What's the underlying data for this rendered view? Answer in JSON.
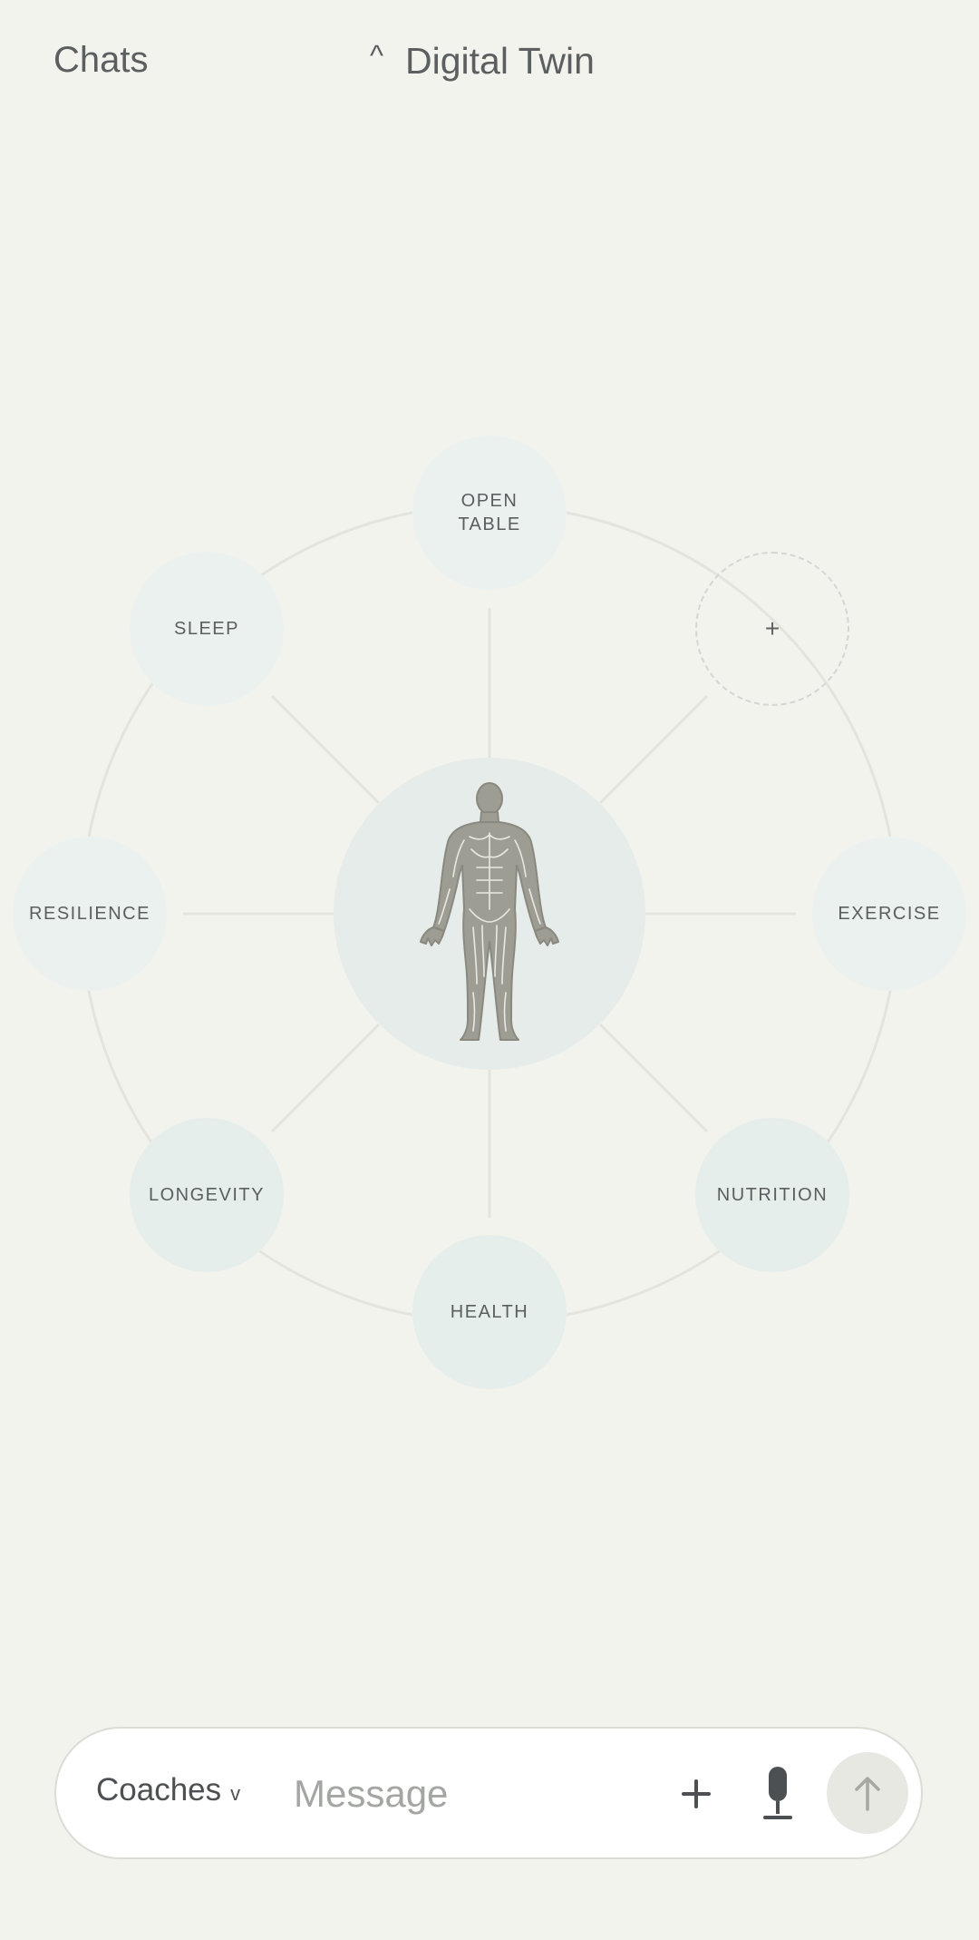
{
  "header": {
    "chats_label": "Chats",
    "caret": "^",
    "title": "Digital Twin"
  },
  "diagram": {
    "center_icon": "human-body-anatomy-icon",
    "nodes": [
      {
        "id": "open-table",
        "line1": "OPEN",
        "line2": "TABLE"
      },
      {
        "id": "add",
        "label": "+"
      },
      {
        "id": "exercise",
        "label": "EXERCISE"
      },
      {
        "id": "nutrition",
        "label": "NUTRITION"
      },
      {
        "id": "health",
        "label": "HEALTH"
      },
      {
        "id": "longevity",
        "label": "LONGEVITY"
      },
      {
        "id": "resilience",
        "label": "RESILIENCE"
      },
      {
        "id": "sleep",
        "label": "SLEEP"
      }
    ]
  },
  "composer": {
    "coaches_label": "Coaches",
    "coaches_chevron": "v",
    "message_placeholder": "Message",
    "icons": [
      "plus-icon",
      "microphone-icon",
      "arrow-up-icon"
    ]
  },
  "colors": {
    "background": "#f3f3ee",
    "node_fill": "#e6eeeb",
    "ring_stroke": "#e4e4de",
    "text": "#55585a",
    "body_figure": "#9e9d93"
  }
}
